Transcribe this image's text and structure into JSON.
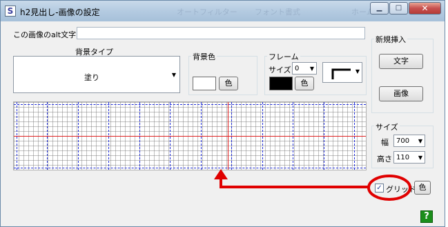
{
  "window": {
    "title": "h2見出し-画像の設定",
    "ghost_tabs": [
      "オートフィルター",
      "フォント書式",
      "ホーム"
    ],
    "app_icon": "S"
  },
  "alt": {
    "label": "この画像のalt文字",
    "value": ""
  },
  "background": {
    "type_label": "背景タイプ",
    "type_value": "塗り",
    "color_label": "背景色",
    "color_button": "色",
    "color": "#ffffff"
  },
  "frame": {
    "label": "フレーム",
    "size_label": "サイズ",
    "size_value": "0",
    "color": "#000000",
    "color_button": "色",
    "style_icon": "corner-line-icon"
  },
  "new_insert": {
    "label": "新規挿入",
    "text_button": "文字",
    "image_button": "画像"
  },
  "size": {
    "label": "サイズ",
    "width_label": "幅",
    "width_value": "700",
    "height_label": "高さ",
    "height_value": "110"
  },
  "grid": {
    "checkbox_label": "グリッド",
    "checked": true,
    "color_button": "色"
  },
  "help_icon": "?",
  "colors": {
    "annotation": "#e00000",
    "grid_major": "#1d2bd8",
    "guide": "#e02020"
  }
}
